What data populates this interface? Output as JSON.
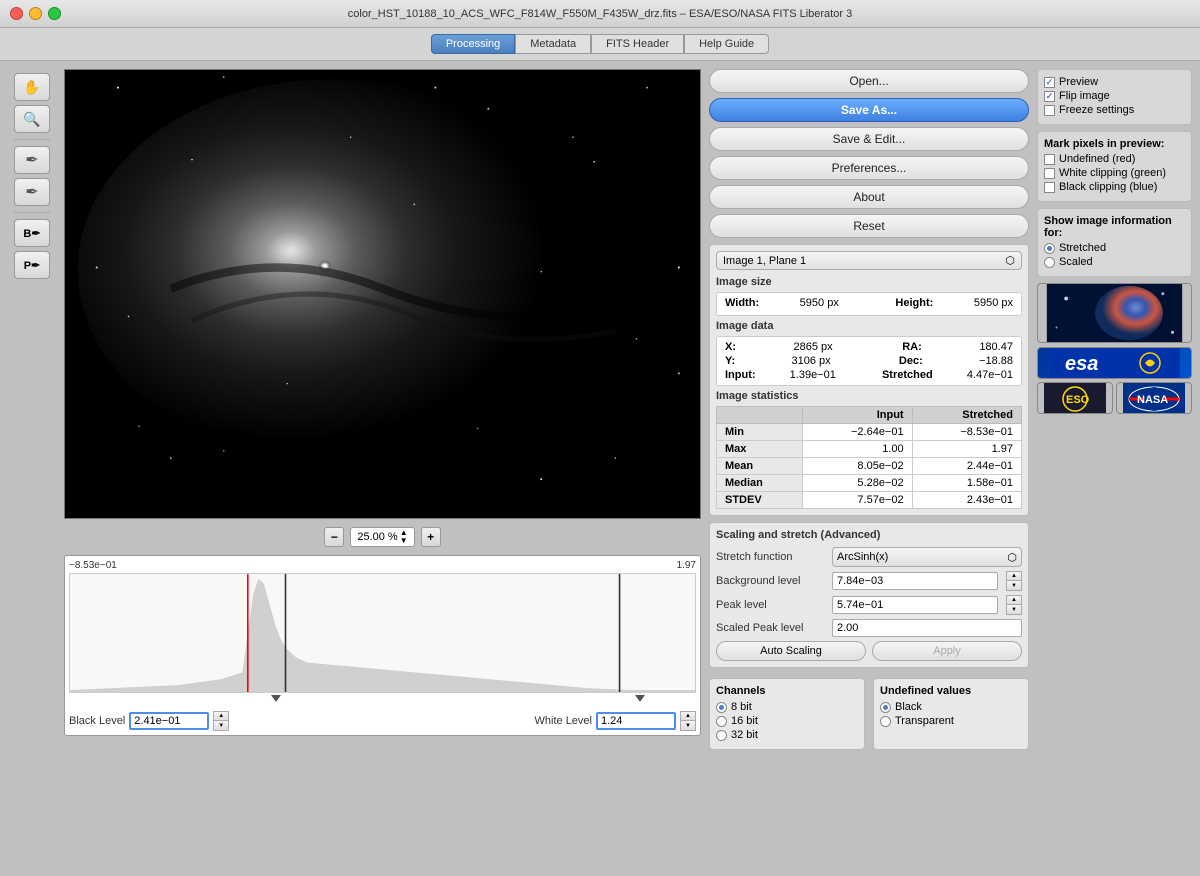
{
  "window": {
    "title": "color_HST_10188_10_ACS_WFC_F814W_F550M_F435W_drz.fits – ESA/ESO/NASA FITS Liberator 3"
  },
  "tabs": [
    {
      "label": "Processing",
      "active": true
    },
    {
      "label": "Metadata",
      "active": false
    },
    {
      "label": "FITS Header",
      "active": false
    },
    {
      "label": "Help Guide",
      "active": false
    }
  ],
  "tools": {
    "hand": "✋",
    "zoom": "🔍",
    "eyedropper1": "🖋",
    "eyedropper2": "🖋",
    "black_point": "B",
    "white_point": "P"
  },
  "zoom": {
    "minus": "−",
    "plus": "+",
    "value": "25.00 %"
  },
  "histogram": {
    "min_label": "−8.53e−01",
    "max_label": "1.97"
  },
  "levels": {
    "black_label": "Black Level",
    "black_value": "2.41e−01",
    "white_label": "White Level",
    "white_value": "1.24"
  },
  "buttons": {
    "open": "Open...",
    "save_as": "Save As...",
    "save_edit": "Save & Edit...",
    "preferences": "Preferences...",
    "about": "About",
    "reset": "Reset"
  },
  "image_select": {
    "value": "Image 1, Plane 1"
  },
  "image_size": {
    "title": "Image size",
    "width_label": "Width:",
    "width_value": "5950 px",
    "height_label": "Height:",
    "height_value": "5950 px"
  },
  "image_data": {
    "title": "Image data",
    "x_label": "X:",
    "x_value": "2865 px",
    "ra_label": "RA:",
    "ra_value": "180.47",
    "y_label": "Y:",
    "y_value": "3106 px",
    "dec_label": "Dec:",
    "dec_value": "−18.88",
    "input_label": "Input:",
    "input_value": "1.39e−01",
    "stretched_label": "Stretched",
    "stretched_value": "4.47e−01"
  },
  "image_stats": {
    "title": "Image statistics",
    "cols": [
      "",
      "Input",
      "Stretched"
    ],
    "rows": [
      {
        "label": "Min",
        "input": "−2.64e−01",
        "stretched": "−8.53e−01"
      },
      {
        "label": "Max",
        "input": "1.00",
        "stretched": "1.97"
      },
      {
        "label": "Mean",
        "input": "8.05e−02",
        "stretched": "2.44e−01"
      },
      {
        "label": "Median",
        "input": "5.28e−02",
        "stretched": "1.58e−01"
      },
      {
        "label": "STDEV",
        "input": "7.57e−02",
        "stretched": "2.43e−01"
      }
    ]
  },
  "scaling": {
    "title": "Scaling and stretch (Advanced)",
    "stretch_function_label": "Stretch function",
    "stretch_function_value": "ArcSinh(x)",
    "background_level_label": "Background level",
    "background_level_value": "7.84e−03",
    "peak_level_label": "Peak level",
    "peak_level_value": "5.74e−01",
    "scaled_peak_label": "Scaled Peak level",
    "scaled_peak_value": "2.00",
    "auto_scaling": "Auto Scaling",
    "apply": "Apply"
  },
  "channels": {
    "title": "Channels",
    "options": [
      "8 bit",
      "16 bit",
      "32 bit"
    ],
    "selected": "8 bit"
  },
  "undefined_values": {
    "title": "Undefined values",
    "options": [
      "Black",
      "Transparent"
    ],
    "selected": "Black"
  },
  "options": {
    "preview_label": "Preview",
    "preview_checked": true,
    "flip_label": "Flip image",
    "flip_checked": true,
    "freeze_label": "Freeze settings",
    "freeze_checked": false
  },
  "mark_pixels": {
    "title": "Mark pixels in preview:",
    "undefined_label": "Undefined (red)",
    "undefined_checked": false,
    "white_clipping_label": "White clipping (green)",
    "white_clipping_checked": false,
    "black_clipping_label": "Black clipping (blue)",
    "black_clipping_checked": false
  },
  "show_info": {
    "title": "Show image information for:",
    "stretched_label": "Stretched",
    "scaled_label": "Scaled",
    "selected": "Stretched"
  }
}
